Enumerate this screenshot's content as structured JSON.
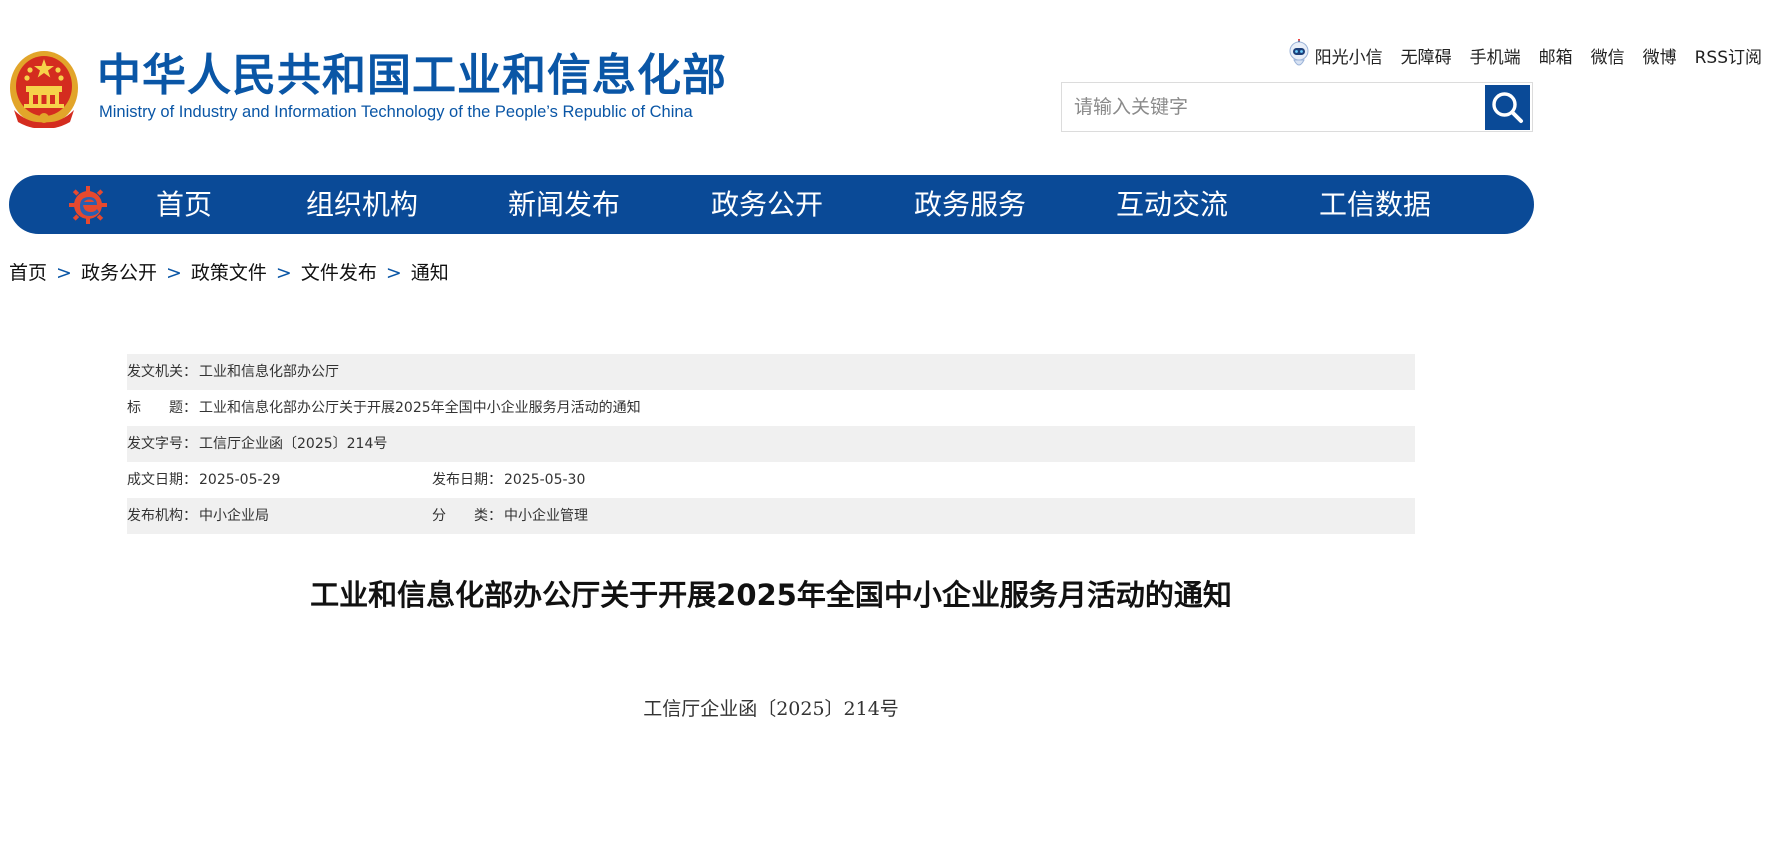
{
  "header": {
    "title": "中华人民共和国工业和信息化部",
    "subtitle": "Ministry of Industry and Information Technology of the People’s Republic of China",
    "top_links": [
      {
        "label": "阳光小信",
        "icon": "robot-mascot-icon"
      },
      {
        "label": "无障碍"
      },
      {
        "label": "手机端"
      },
      {
        "label": "邮箱"
      },
      {
        "label": "微信"
      },
      {
        "label": "微博"
      },
      {
        "label": "RSS订阅"
      }
    ],
    "search": {
      "placeholder": "请输入关键字",
      "value": "",
      "icon": "search-icon"
    }
  },
  "nav": {
    "items": [
      {
        "label": "首页"
      },
      {
        "label": "组织机构"
      },
      {
        "label": "新闻发布"
      },
      {
        "label": "政务公开"
      },
      {
        "label": "政务服务"
      },
      {
        "label": "互动交流"
      },
      {
        "label": "工信数据"
      }
    ]
  },
  "breadcrumb": {
    "items": [
      "首页",
      "政务公开",
      "政策文件",
      "文件发布",
      "通知"
    ],
    "separator": ">"
  },
  "info": {
    "issuer_label": "发文机关：",
    "issuer_value": "工业和信息化部办公厅",
    "title_label": "标　　题：",
    "title_value": "工业和信息化部办公厅关于开展2025年全国中小企业服务月活动的通知",
    "docno_label": "发文字号：",
    "docno_value": "工信厅企业函〔2025〕214号",
    "created_label": "成文日期：",
    "created_value": "2025-05-29",
    "published_label": "发布日期：",
    "published_value": "2025-05-30",
    "org_label": "发布机构：",
    "org_value": "中小企业局",
    "category_label": "分　　类：",
    "category_value": "中小企业管理"
  },
  "article": {
    "title": "工业和信息化部办公厅关于开展2025年全国中小企业服务月活动的通知",
    "doc_number": "工信厅企业函〔2025〕214号"
  },
  "colors": {
    "brand_blue": "#0a4a97",
    "title_blue": "#0a56a6",
    "row_shade": "#f0f0f0"
  }
}
